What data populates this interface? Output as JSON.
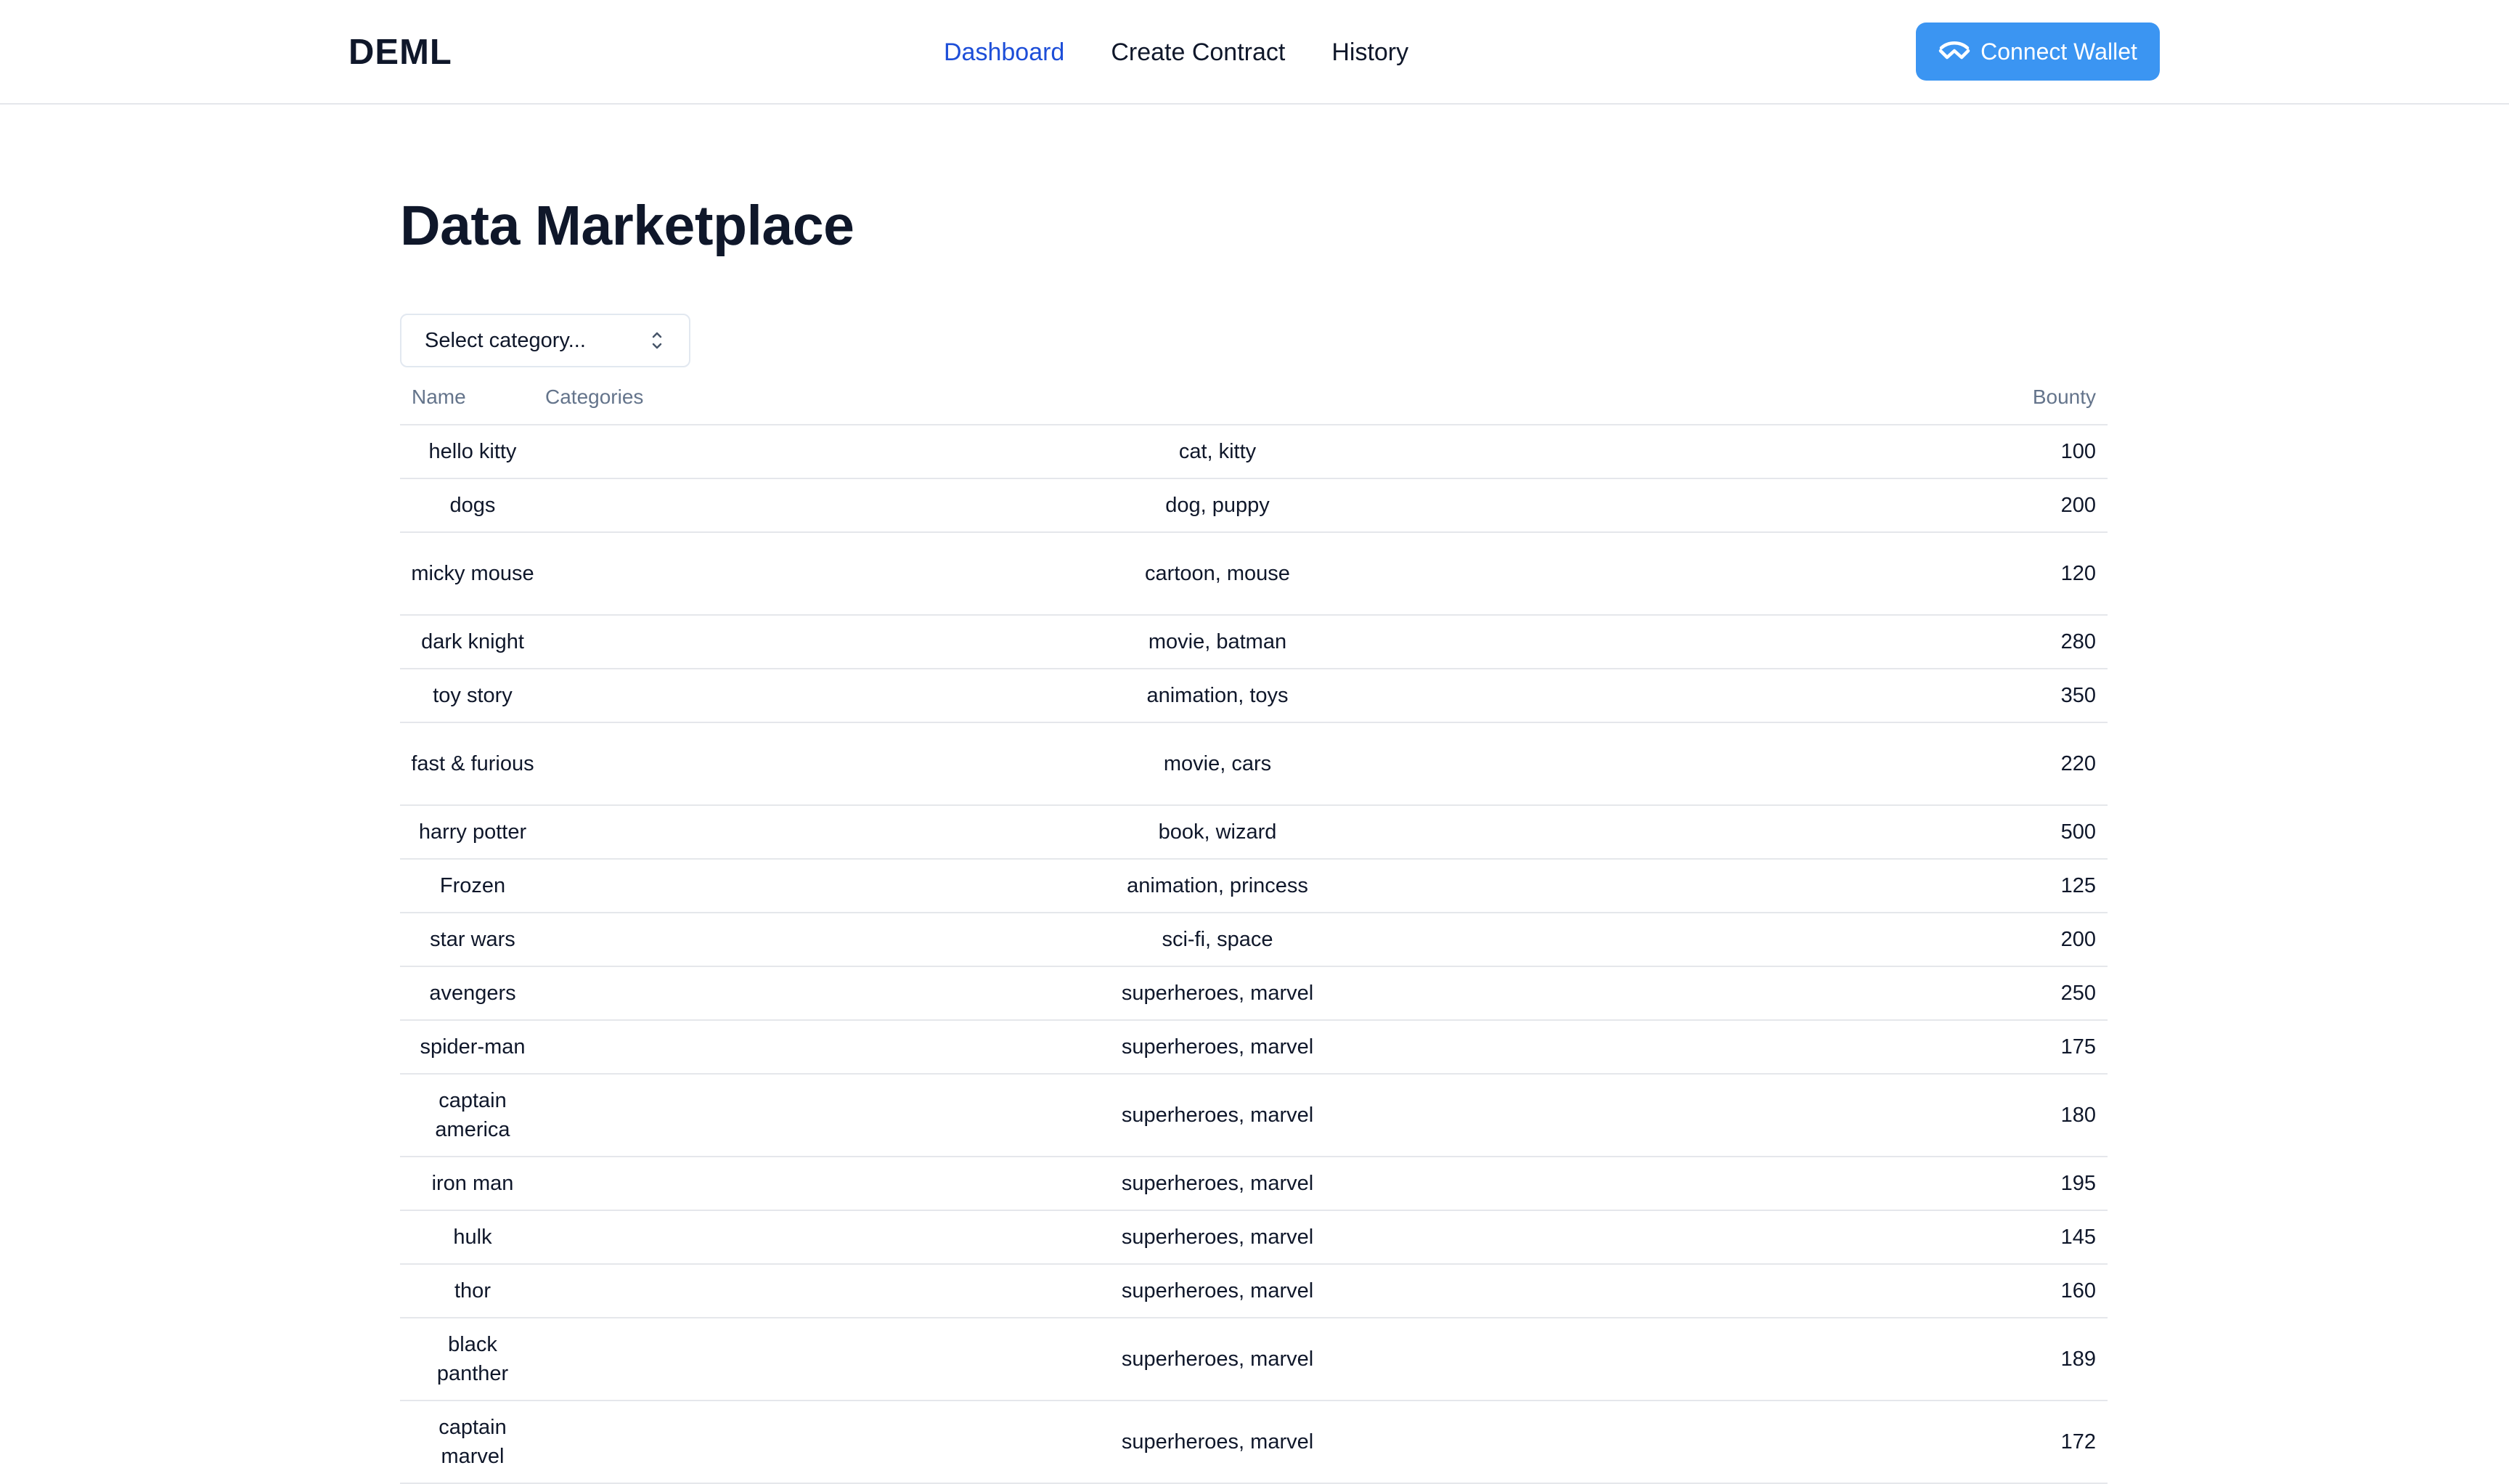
{
  "header": {
    "logo": "DEML",
    "nav": [
      {
        "label": "Dashboard",
        "active": true
      },
      {
        "label": "Create Contract",
        "active": false
      },
      {
        "label": "History",
        "active": false
      }
    ],
    "connect_wallet_label": "Connect Wallet"
  },
  "colors": {
    "accent": "#3b95f2",
    "nav_active": "#1d4ed8",
    "text": "#0f172a",
    "muted": "#64748b"
  },
  "main": {
    "title": "Data Marketplace",
    "category_select": {
      "value": "Select category..."
    },
    "table": {
      "headers": {
        "name": "Name",
        "categories": "Categories",
        "bounty": "Bounty"
      },
      "rows": [
        {
          "name": "hello kitty",
          "categories": "cat, kitty",
          "bounty": "100"
        },
        {
          "name": "dogs",
          "categories": "dog, puppy",
          "bounty": "200"
        },
        {
          "name": "micky mouse",
          "categories": "cartoon, mouse",
          "bounty": "120"
        },
        {
          "name": "dark knight",
          "categories": "movie, batman",
          "bounty": "280"
        },
        {
          "name": "toy story",
          "categories": "animation, toys",
          "bounty": "350"
        },
        {
          "name": "fast & furious",
          "categories": "movie, cars",
          "bounty": "220"
        },
        {
          "name": "harry potter",
          "categories": "book, wizard",
          "bounty": "500"
        },
        {
          "name": "Frozen",
          "categories": "animation, princess",
          "bounty": "125"
        },
        {
          "name": "star wars",
          "categories": "sci-fi, space",
          "bounty": "200"
        },
        {
          "name": "avengers",
          "categories": "superheroes, marvel",
          "bounty": "250"
        },
        {
          "name": "spider-man",
          "categories": "superheroes, marvel",
          "bounty": "175"
        },
        {
          "name": "captain america",
          "categories": "superheroes, marvel",
          "bounty": "180"
        },
        {
          "name": "iron man",
          "categories": "superheroes, marvel",
          "bounty": "195"
        },
        {
          "name": "hulk",
          "categories": "superheroes, marvel",
          "bounty": "145"
        },
        {
          "name": "thor",
          "categories": "superheroes, marvel",
          "bounty": "160"
        },
        {
          "name": "black panther",
          "categories": "superheroes, marvel",
          "bounty": "189"
        },
        {
          "name": "captain marvel",
          "categories": "superheroes, marvel",
          "bounty": "172"
        }
      ]
    }
  }
}
